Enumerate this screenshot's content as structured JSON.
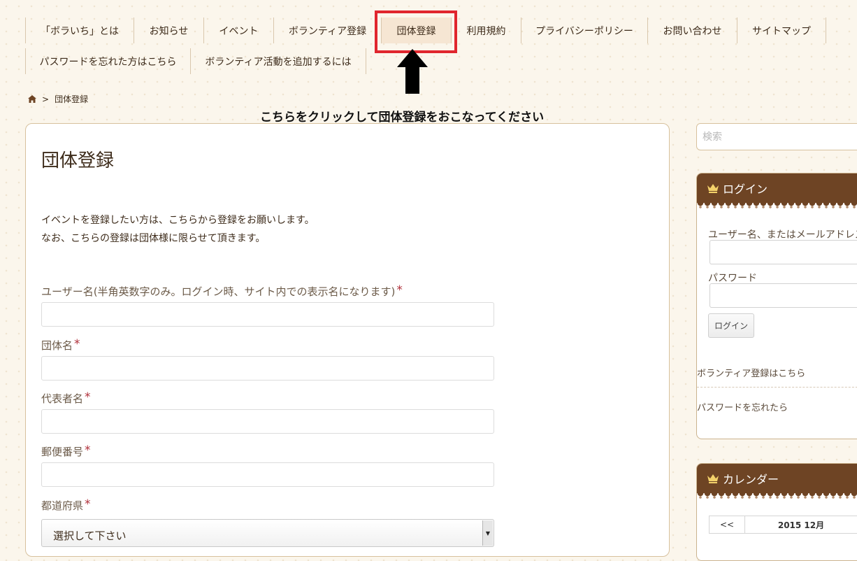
{
  "nav": {
    "row1": [
      {
        "label": "「ボラいち」とは",
        "width": 155
      },
      {
        "label": "お知らせ",
        "width": 100
      },
      {
        "label": "イベント",
        "width": 100
      },
      {
        "label": "ボランティア登録",
        "width": 154
      },
      {
        "label": "団体登録",
        "width": 100,
        "active": true
      },
      {
        "label": "利用規約",
        "width": 100
      },
      {
        "label": "プライバシーポリシー",
        "width": 181
      },
      {
        "label": "お問い合わせ",
        "width": 128
      },
      {
        "label": "サイトマップ",
        "width": 128
      }
    ],
    "row2": [
      {
        "label": "パスワードを忘れた方はこちら",
        "width": 236
      },
      {
        "label": "ボランティア活動を追加するには",
        "width": 252
      }
    ]
  },
  "breadcrumb": {
    "separator": ">",
    "current": "団体登録"
  },
  "annotation": "こちらをクリックして団体登録をおこなってください",
  "main": {
    "title": "団体登録",
    "intro_line1": "イベントを登録したい方は、こちらから登録をお願いします。",
    "intro_line2": "なお、こちらの登録は団体様に限らせて頂きます。",
    "required_mark": "*",
    "fields": {
      "username_label": "ユーザー名(半角英数字のみ。ログイン時、サイト内での表示名になります)",
      "group_name_label": "団体名",
      "representative_label": "代表者名",
      "postal_code_label": "郵便番号",
      "prefecture_label": "都道府県",
      "prefecture_selected": "選択して下さい"
    }
  },
  "sidebar": {
    "search_placeholder": "検索",
    "login_widget": {
      "title": "ログイン",
      "username_label": "ユーザー名、またはメールアドレス",
      "password_label": "パスワード",
      "login_button": "ログイン",
      "volunteer_link": "ボランティア登録はこちら",
      "forgot_link": "パスワードを忘れたら"
    },
    "calendar_widget": {
      "title": "カレンダー",
      "prev": "<<",
      "month": "2015 12月"
    }
  },
  "colors": {
    "highlight": "#e0262e",
    "widget_header": "#6e4424",
    "required": "#b0303a"
  }
}
